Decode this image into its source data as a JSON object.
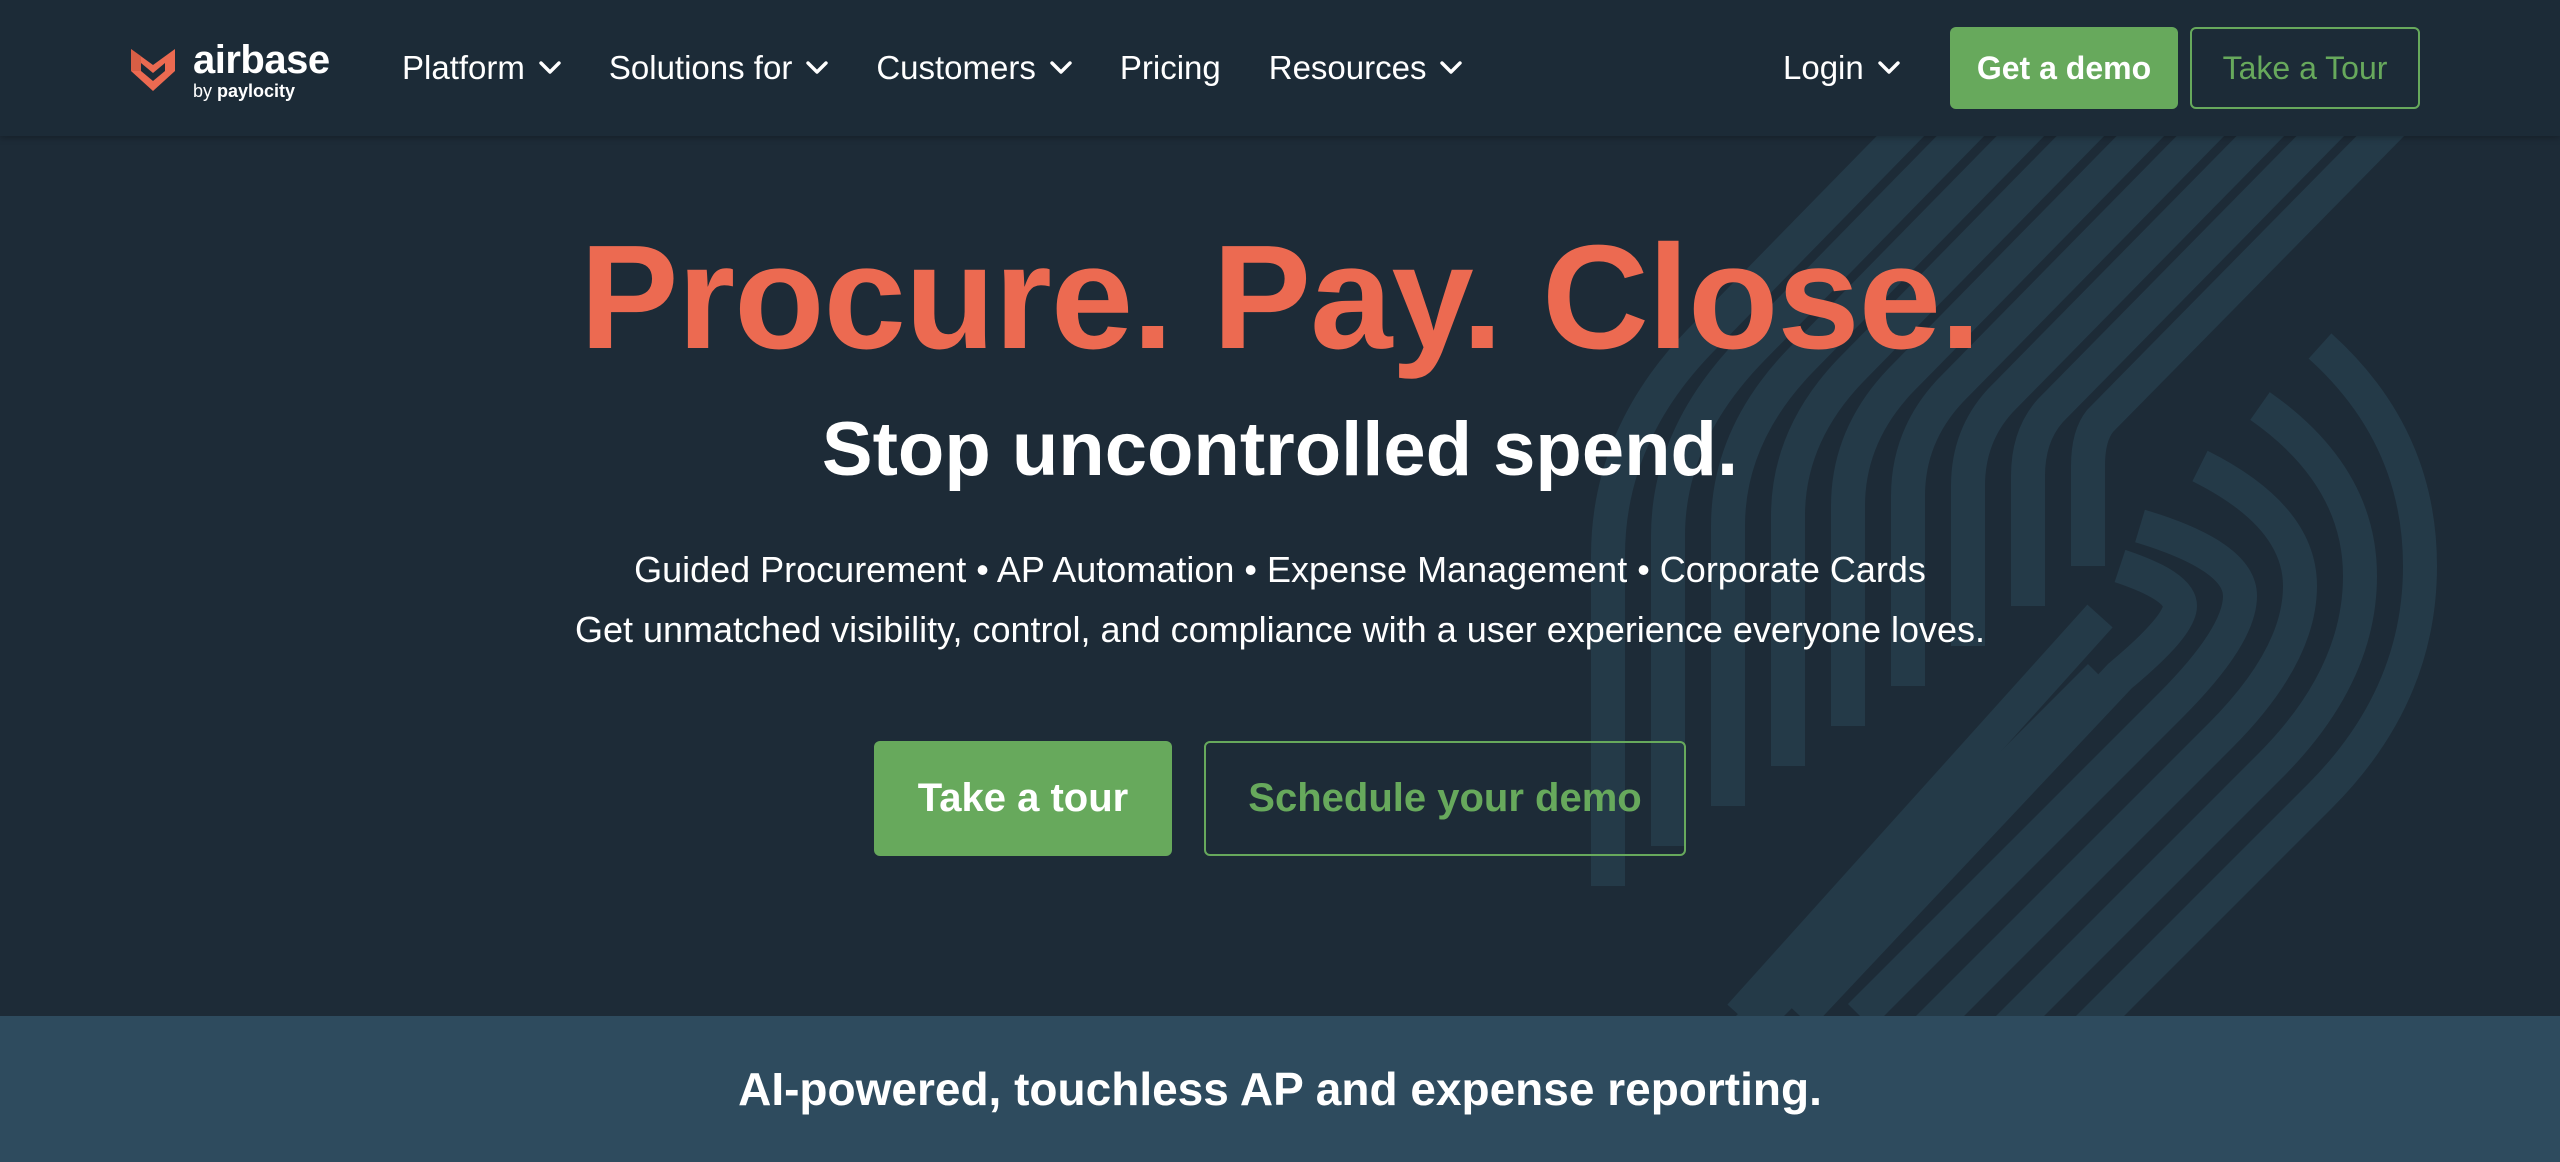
{
  "brand": {
    "name": "airbase",
    "by": "by",
    "parent": "paylocity",
    "accent": "#ec6a51"
  },
  "nav": {
    "items": [
      {
        "label": "Platform",
        "dropdown": true
      },
      {
        "label": "Solutions for",
        "dropdown": true
      },
      {
        "label": "Customers",
        "dropdown": true
      },
      {
        "label": "Pricing",
        "dropdown": false
      },
      {
        "label": "Resources",
        "dropdown": true
      }
    ],
    "login": "Login",
    "demo_button": "Get a demo",
    "tour_button": "Take a Tour"
  },
  "hero": {
    "title": "Procure. Pay. Close.",
    "subtitle": "Stop uncontrolled spend.",
    "features": "Guided Procurement • AP Automation • Expense Management • Corporate Cards",
    "description": "Get unmatched visibility, control, and compliance with a user experience everyone loves.",
    "primary_cta": "Take a tour",
    "secondary_cta": "Schedule your demo"
  },
  "band": {
    "text": "AI-powered, touchless AP and expense reporting."
  },
  "colors": {
    "background": "#1d2b37",
    "green": "#67a95c",
    "band": "#2e4b5e",
    "pattern": "#243a48"
  },
  "icons": {
    "logo": "airbase-chevron-logo-icon",
    "dropdown": "chevron-down-icon"
  }
}
